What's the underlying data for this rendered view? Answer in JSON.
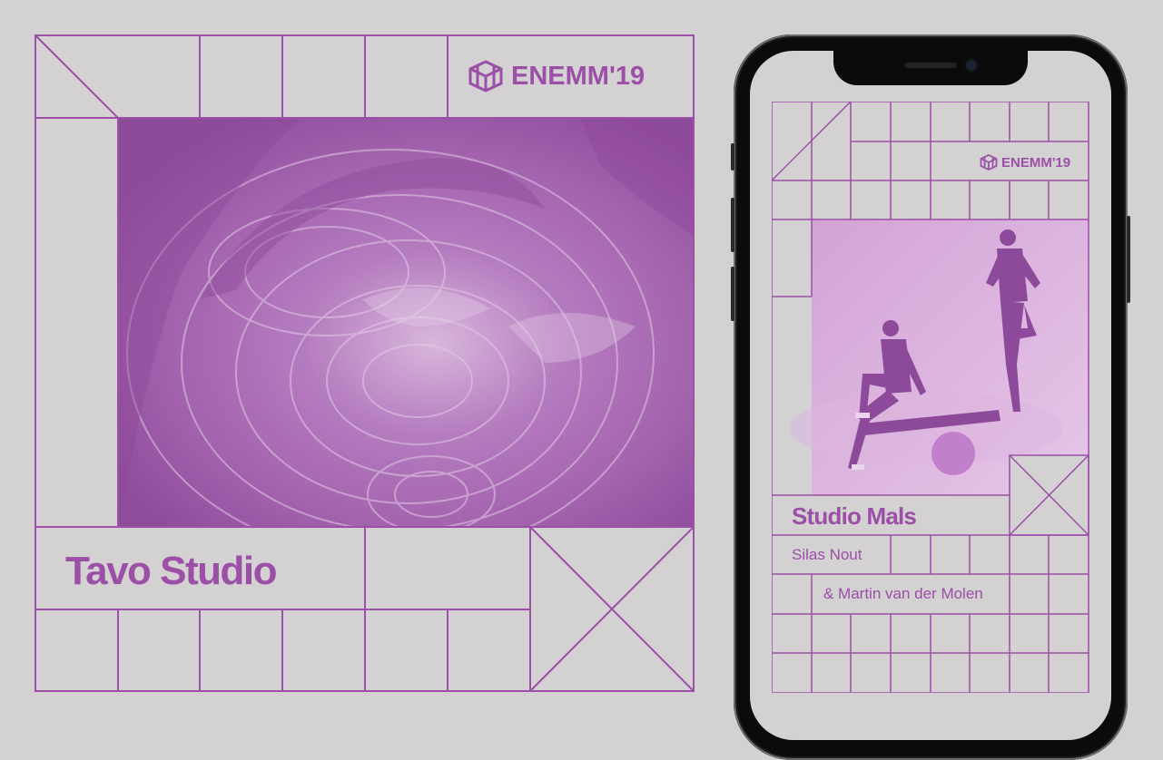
{
  "poster": {
    "logo_text": "ENEMM'19",
    "studio_name": "Tavo Studio",
    "accent_color": "#9b4fa6",
    "image_tint": "#b77fc0"
  },
  "phone": {
    "logo_text": "ENEMM'19",
    "studio_name": "Studio Mals",
    "member_1": "Silas Nout",
    "member_2": "& Martin van der Molen"
  }
}
